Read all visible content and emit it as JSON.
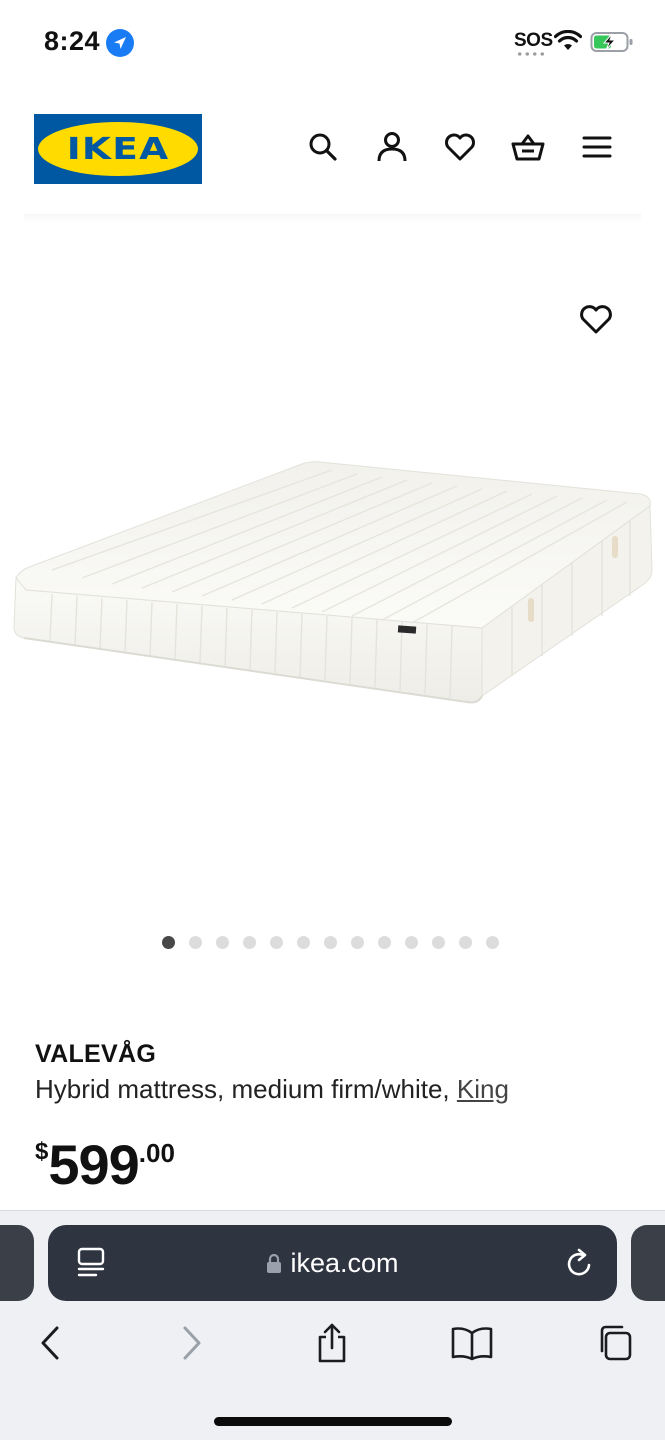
{
  "status_bar": {
    "time": "8:24",
    "sos_label": "SOS",
    "battery_state": "charging"
  },
  "header": {
    "logo_text": "IKEA",
    "icons": [
      "search-icon",
      "account-icon",
      "heart-icon",
      "cart-icon",
      "menu-icon"
    ]
  },
  "product": {
    "name": "VALEVÅG",
    "description": "Hybrid mattress, medium firm/white, ",
    "size_link": "King",
    "price_currency": "$",
    "price_whole": "599",
    "price_cents": ".00",
    "image_count": 13,
    "active_image_index": 0
  },
  "browser": {
    "url": "ikea.com"
  },
  "colors": {
    "ikea_blue": "#0058a3",
    "ikea_yellow": "#ffdb00",
    "url_bar_bg": "#2e3440",
    "location_blue": "#1a7cf5",
    "battery_green": "#35c759"
  }
}
